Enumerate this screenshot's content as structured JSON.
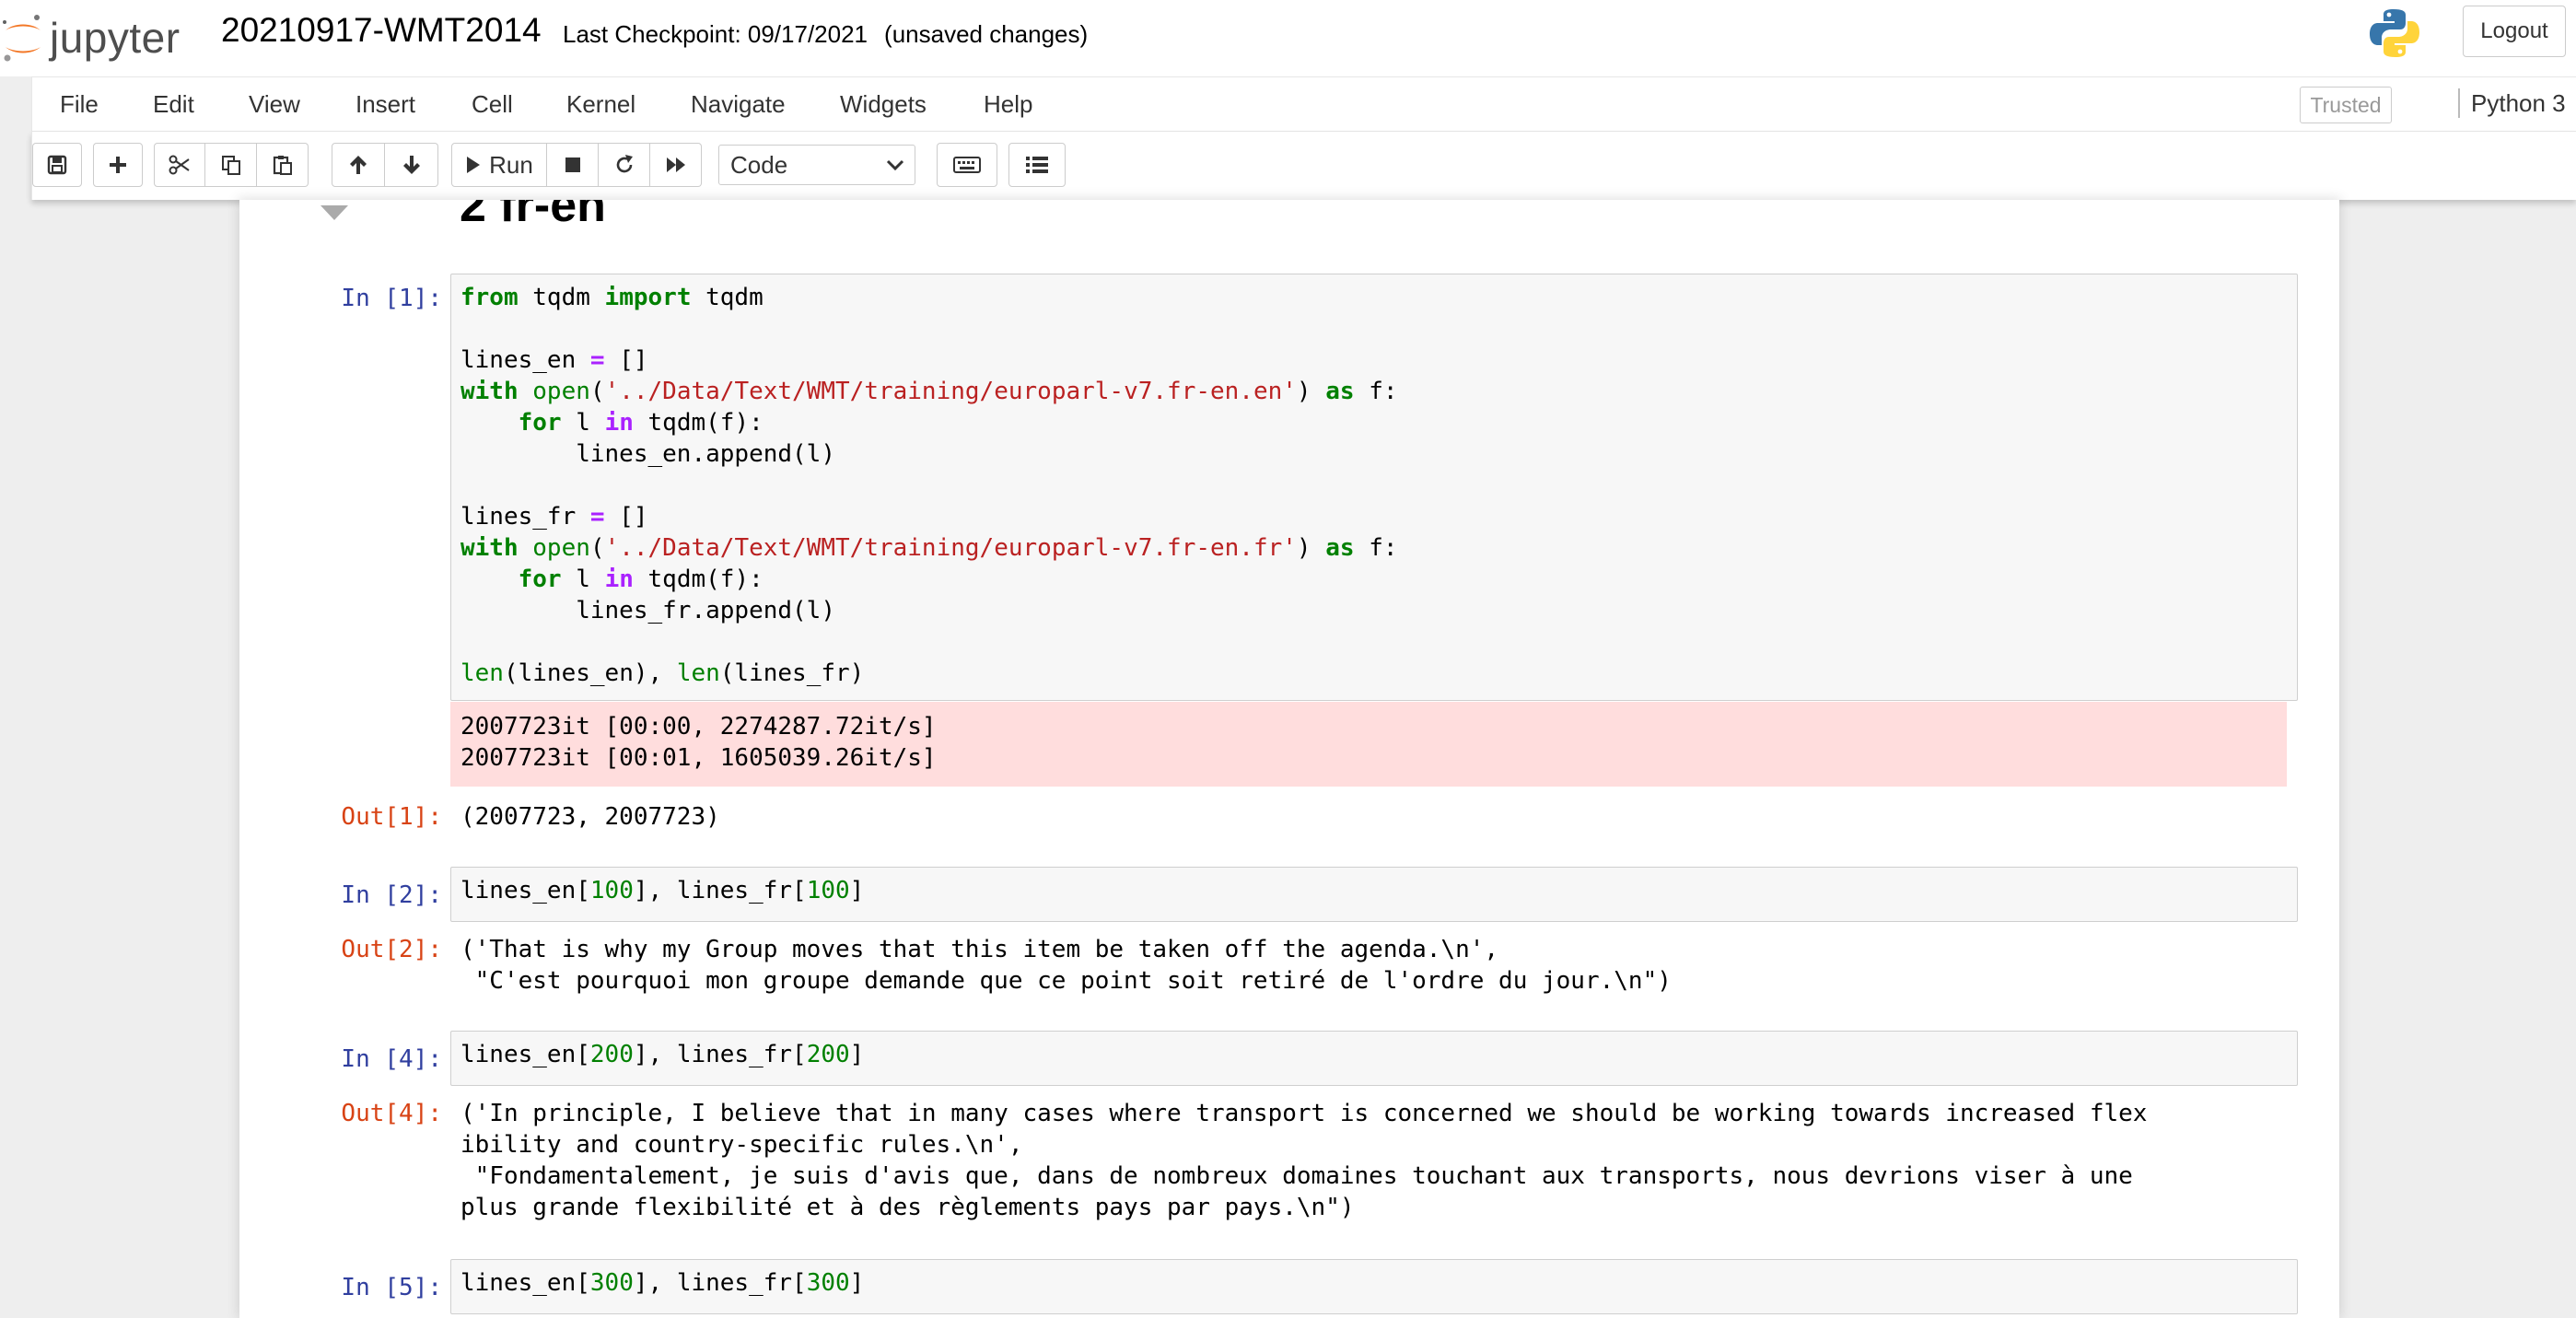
{
  "header": {
    "logo_text": "jupyter",
    "notebook_title": "20210917-WMT2014",
    "checkpoint": "Last Checkpoint: 09/17/2021",
    "unsaved": "(unsaved changes)",
    "logout_label": "Logout"
  },
  "menubar": {
    "items": [
      "File",
      "Edit",
      "View",
      "Insert",
      "Cell",
      "Kernel",
      "Navigate",
      "Widgets",
      "Help"
    ],
    "trusted_label": "Trusted",
    "kernel_name": "Python 3"
  },
  "toolbar": {
    "run_label": "Run",
    "cell_type": "Code"
  },
  "notebook": {
    "heading": "2  fr-en",
    "cells": [
      {
        "prompt": "In [1]:",
        "code": [
          [
            [
              "from",
              "kw"
            ],
            [
              " tqdm ",
              ""
            ],
            [
              "import",
              "kw"
            ],
            [
              " tqdm",
              ""
            ]
          ],
          [],
          [
            [
              "lines_en ",
              ""
            ],
            [
              "=",
              "op"
            ],
            [
              " []",
              ""
            ]
          ],
          [
            [
              "with",
              "kw"
            ],
            [
              " ",
              ""
            ],
            [
              "open",
              "bi"
            ],
            [
              "(",
              ""
            ],
            [
              "'../Data/Text/WMT/training/europarl-v7.fr-en.en'",
              "st"
            ],
            [
              ") ",
              ""
            ],
            [
              "as",
              "kw"
            ],
            [
              " f:",
              ""
            ]
          ],
          [
            [
              "    ",
              ""
            ],
            [
              "for",
              "kw"
            ],
            [
              " l ",
              ""
            ],
            [
              "in",
              "op"
            ],
            [
              " tqdm(f):",
              ""
            ]
          ],
          [
            [
              "        lines_en.append(l)",
              ""
            ]
          ],
          [],
          [
            [
              "lines_fr ",
              ""
            ],
            [
              "=",
              "op"
            ],
            [
              " []",
              ""
            ]
          ],
          [
            [
              "with",
              "kw"
            ],
            [
              " ",
              ""
            ],
            [
              "open",
              "bi"
            ],
            [
              "(",
              ""
            ],
            [
              "'../Data/Text/WMT/training/europarl-v7.fr-en.fr'",
              "st"
            ],
            [
              ") ",
              ""
            ],
            [
              "as",
              "kw"
            ],
            [
              " f:",
              ""
            ]
          ],
          [
            [
              "    ",
              ""
            ],
            [
              "for",
              "kw"
            ],
            [
              " l ",
              ""
            ],
            [
              "in",
              "op"
            ],
            [
              " tqdm(f):",
              ""
            ]
          ],
          [
            [
              "        lines_fr.append(l)",
              ""
            ]
          ],
          [],
          [
            [
              "len",
              "bi"
            ],
            [
              "(lines_en), ",
              ""
            ],
            [
              "len",
              "bi"
            ],
            [
              "(lines_fr)",
              ""
            ]
          ]
        ],
        "stderr": [
          "2007723it [00:00, 2274287.72it/s]",
          "2007723it [00:01, 1605039.26it/s]"
        ],
        "out_prompt": "Out[1]:",
        "output": "(2007723, 2007723)"
      },
      {
        "prompt": "In [2]:",
        "code": [
          [
            [
              "lines_en[",
              ""
            ],
            [
              "100",
              "nu"
            ],
            [
              "], lines_fr[",
              ""
            ],
            [
              "100",
              "nu"
            ],
            [
              "]",
              ""
            ]
          ]
        ],
        "out_prompt": "Out[2]:",
        "output": "('That is why my Group moves that this item be taken off the agenda.\\n',\n \"C'est pourquoi mon groupe demande que ce point soit retiré de l'ordre du jour.\\n\")"
      },
      {
        "prompt": "In [4]:",
        "code": [
          [
            [
              "lines_en[",
              ""
            ],
            [
              "200",
              "nu"
            ],
            [
              "], lines_fr[",
              ""
            ],
            [
              "200",
              "nu"
            ],
            [
              "]",
              ""
            ]
          ]
        ],
        "out_prompt": "Out[4]:",
        "output": "('In principle, I believe that in many cases where transport is concerned we should be working towards increased flex\nibility and country-specific rules.\\n',\n \"Fondamentalement, je suis d'avis que, dans de nombreux domaines touchant aux transports, nous devrions viser à une\nplus grande flexibilité et à des règlements pays par pays.\\n\")"
      },
      {
        "prompt": "In [5]:",
        "code": [
          [
            [
              "lines_en[",
              ""
            ],
            [
              "300",
              "nu"
            ],
            [
              "], lines_fr[",
              ""
            ],
            [
              "300",
              "nu"
            ],
            [
              "]",
              ""
            ]
          ]
        ]
      }
    ]
  }
}
